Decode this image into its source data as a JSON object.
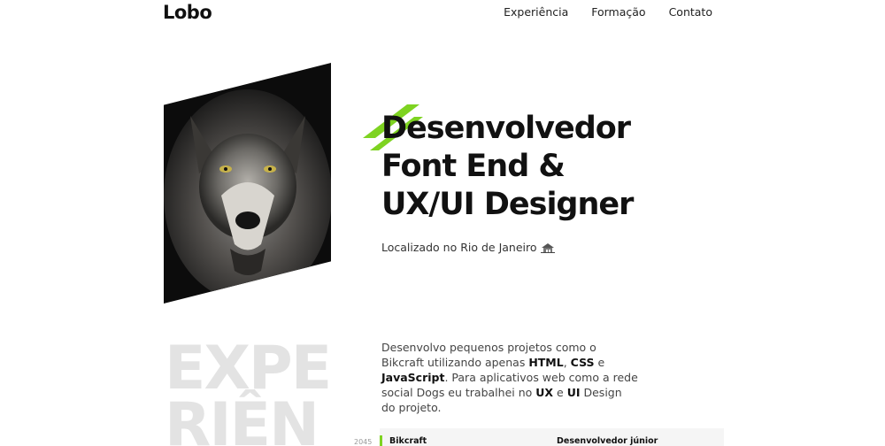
{
  "brand": {
    "logo": "Lobo"
  },
  "nav": {
    "items": [
      "Experiência",
      "Formação",
      "Contato"
    ]
  },
  "hero": {
    "headline_line1": "Desenvolvedor",
    "headline_line2": "Font End &",
    "headline_line3": "UX/UI Designer",
    "location": "Localizado no Rio de Janeiro",
    "location_icon": "house-icon"
  },
  "about": {
    "t1": "Desenvolvo pequenos projetos como o Bikcraft utilizando apenas ",
    "html": "HTML",
    "t2": ", ",
    "css": "CSS",
    "t3": " e ",
    "js": "JavaScript",
    "t4": ". Para aplicativos web como a rede social Dogs eu trabalhei no ",
    "ux": "UX",
    "t5": " e ",
    "ui": "UI",
    "t6": " Design do projeto."
  },
  "experience": {
    "heading_line1": "EXPE",
    "heading_line2": "RIÊN",
    "year": "2045",
    "company": "Bikcraft",
    "role": "Desenvolvedor júnior"
  },
  "colors": {
    "accent": "#7ed321",
    "text": "#111111",
    "muted": "#e3e3e3"
  }
}
